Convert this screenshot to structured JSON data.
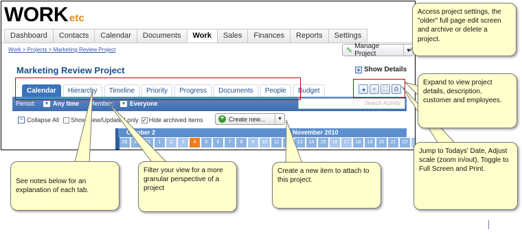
{
  "logo": {
    "main": "WORK",
    "sub": "etc"
  },
  "nav": [
    "Dashboard",
    "Contacts",
    "Calendar",
    "Documents",
    "Work",
    "Sales",
    "Finances",
    "Reports",
    "Settings"
  ],
  "nav_active": "Work",
  "breadcrumb": "Work > Projects > Marketing Review Project",
  "manage_button": "Manage Project",
  "project_title": "Marketing Review Project",
  "show_details": "Show Details",
  "project_tabs": [
    "Calendar",
    "Hierarchy",
    "Timeline",
    "Priority",
    "Progress",
    "Documents",
    "People",
    "Budget"
  ],
  "project_tab_active": "Calendar",
  "filter": {
    "period_label": "Period:",
    "period_value": "Any time",
    "member_label": "Member:",
    "member_value": "Everyone",
    "search_placeholder": "Search Activity"
  },
  "options": {
    "collapse_all": "Collapse All",
    "show_new": "Show New/Updated only",
    "hide_archived": "Hide archived items",
    "create_new": "Create new..."
  },
  "calendar": {
    "month_left": "October 2",
    "month_right": "November 2010",
    "days": [
      "29",
      "30",
      "31",
      "1",
      "2",
      "3",
      "4",
      "5",
      "6",
      "7",
      "8",
      "9",
      "10",
      "11",
      "12",
      "13",
      "14",
      "15",
      "16",
      "17",
      "18",
      "19",
      "20",
      "21",
      "22",
      "23"
    ],
    "today": "4"
  },
  "callouts": {
    "settings": "Access project settings, the \"older\" full page edit screen and archive or delete a project.",
    "expand": "Expand to view project details, description, customer and employees.",
    "jump": "Jump to Todays' Date, Adjust scale (zoom in/out), Toggle to Full Screen and Print.",
    "tabs": "See notes below for an explanation of each tab.",
    "filter": "Filter your view for a more granular perspective of a project",
    "create": "Create a new item to attach to this project."
  },
  "colors": {
    "accent_blue": "#3d72b8",
    "callout_bg": "#ffffcc",
    "highlight_red": "#c00000",
    "today": "#f07d1c",
    "logo_etc": "#e38a0e"
  }
}
